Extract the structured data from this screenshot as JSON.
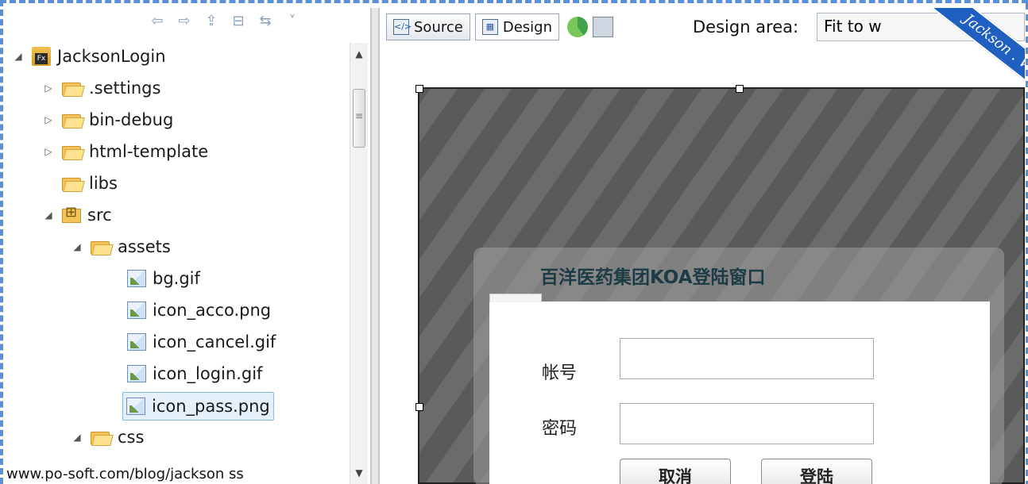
{
  "tree": {
    "items": [
      {
        "label": "JacksonLogin",
        "expanded": "open"
      },
      {
        "label": ".settings",
        "expanded": "closed"
      },
      {
        "label": "bin-debug",
        "expanded": "closed"
      },
      {
        "label": "html-template",
        "expanded": "closed"
      },
      {
        "label": "libs",
        "expanded": "none"
      },
      {
        "label": "src",
        "expanded": "open"
      },
      {
        "label": "assets",
        "expanded": "open"
      },
      {
        "label": "bg.gif"
      },
      {
        "label": "icon_acco.png"
      },
      {
        "label": "icon_cancel.gif"
      },
      {
        "label": "icon_login.gif"
      },
      {
        "label": "icon_pass.png",
        "selected": true
      },
      {
        "label": "css",
        "expanded": "open"
      }
    ]
  },
  "watermark": "www.po-soft.com/blog/jackson ss",
  "editor": {
    "tabs": {
      "source": "Source",
      "design": "Design"
    },
    "design_area_label": "Design area:",
    "design_area_value": "Fit to w",
    "ribbon_text": "Jackson . Wang"
  },
  "login": {
    "title": "百洋医药集团KOA登陆窗口",
    "account_label": "帐号",
    "password_label": "密码",
    "cancel_button": "取消",
    "login_button": "登陆"
  }
}
